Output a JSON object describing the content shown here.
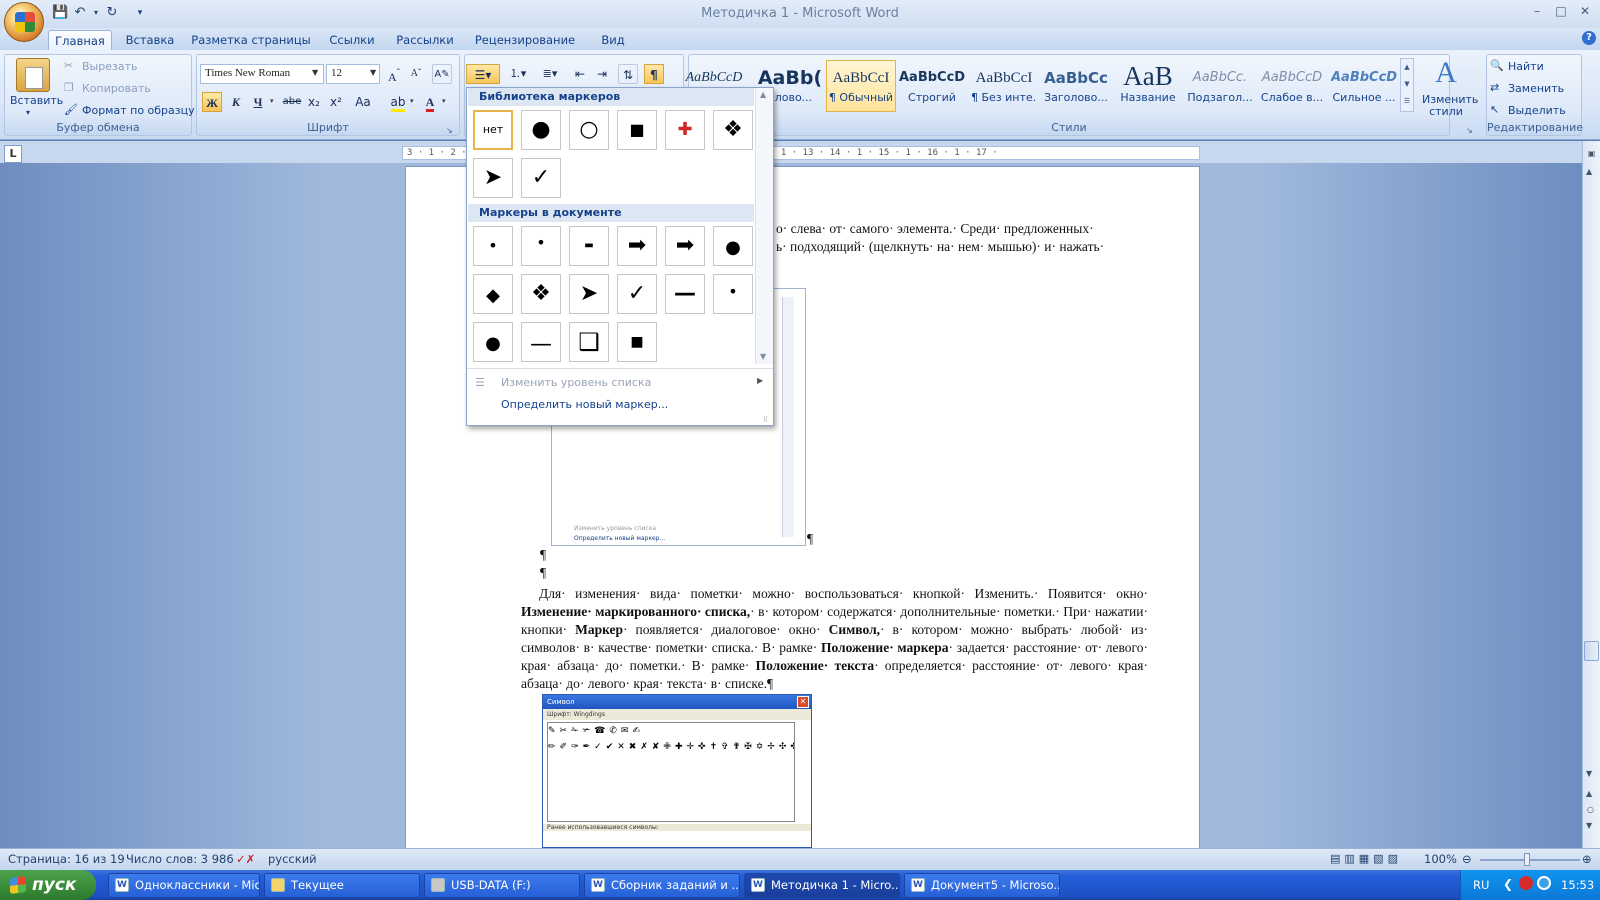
{
  "window": {
    "title": "Методичка 1 - Microsoft Word",
    "controls": {
      "minimize": "–",
      "maximize": "□",
      "close": "✕"
    }
  },
  "tabs": [
    "Главная",
    "Вставка",
    "Разметка страницы",
    "Ссылки",
    "Рассылки",
    "Рецензирование",
    "Вид"
  ],
  "active_tab": "Главная",
  "ribbon": {
    "clipboard": {
      "label": "Буфер обмена",
      "paste": "Вставить",
      "cut": "Вырезать",
      "copy": "Копировать",
      "format_painter": "Формат по образцу"
    },
    "font": {
      "label": "Шрифт",
      "font_name": "Times New Roman",
      "font_size": "12",
      "bold": "Ж",
      "italic": "К",
      "underline": "Ч",
      "strike": "abe",
      "sub": "x₂",
      "sup": "x²",
      "case": "Aa"
    },
    "styles": {
      "label": "Стили",
      "items": [
        {
          "sample": "AaBbCcD",
          "name": ""
        },
        {
          "sample": "AaBb(",
          "name": "оловo..."
        },
        {
          "sample": "AaBbCcI",
          "name": "¶ Обычный"
        },
        {
          "sample": "AaBbCcD",
          "name": "Строгий"
        },
        {
          "sample": "AaBbCcI",
          "name": "¶ Без инте..."
        },
        {
          "sample": "AaBbCc",
          "name": "Заголово..."
        },
        {
          "sample": "AaB",
          "name": "Название"
        },
        {
          "sample": "AaBbCc.",
          "name": "Подзагол..."
        },
        {
          "sample": "AaBbCcD",
          "name": "Слабое в..."
        },
        {
          "sample": "AaBbCcD",
          "name": "Сильное ..."
        }
      ],
      "change_styles": "Изменить стили"
    },
    "editing": {
      "label": "Редактирование",
      "find": "Найти",
      "replace": "Заменить",
      "select": "Выделить"
    }
  },
  "ruler": "3 · 1 · 2 · 1 · 1 ·                                                                  · 7 · 1 · 8 · 1 · 9 · 1 · 10 · 1 · 11 · 1 · 12 · 1 · 13 · 14 · 1 · 15 · 1 · 16 · 1 · 17 ·",
  "bullet_dropdown": {
    "library_header": "Библиотека маркеров",
    "library": [
      "нет",
      "●",
      "○",
      "■",
      "✚",
      "❖",
      "➤",
      "✓"
    ],
    "document_header": "Маркеры в документе",
    "document": [
      "•",
      "•",
      "▬",
      "➡",
      "➡",
      "●",
      "◆",
      "❖",
      "➤",
      "✓",
      "—",
      "•",
      "●",
      "—",
      "❑",
      "■"
    ],
    "change_level": "Изменить уровень списка",
    "define_new": "Определить новый маркер..."
  },
  "document": {
    "line1": "о· слева· от· самого· элемента.· Среди· предложенных·",
    "line2": "ь· подходящий· (щелкнуть· на· нем· мышью)· и· нажать·",
    "para_marks": [
      "¶",
      "¶",
      "¶"
    ],
    "para_html": "Для· изменения· вида· пометки· можно· воспользоваться· кнопкой· Изменить.· Появится· окно· <b>Изменение· маркированного· списка,</b>· в· котором· содержатся· дополнительные· пометки.· При· нажатии· кнопки· <b>Маркер</b>· появляется· диалоговое· окно· <b>Символ,</b>· в· котором· можно· выбрать· любой· из· символов· в· качестве· пометки· списка.· В· рамке· <b>Положение· маркера</b>· задается· расстояние· от· левого· края· абзаца· до· пометки.· В· рамке· <b>Положение· текста</b>· определяется· расстояние· от· левого· края· абзаца· до· левого· края· текста· в· списке.¶",
    "symbol_dialog_title": "Символ",
    "symbol_font_label": "Шрифт: Wingdings",
    "symbol_recent_label": "Ранее использовавшиеся символы:",
    "inset_change_level": "Изменить уровень списка",
    "inset_define": "Определить новый маркер..."
  },
  "status": {
    "page": "Страница: 16 из 19",
    "words": "Число слов: 3 986",
    "language": "русский",
    "zoom": "100%"
  },
  "taskbar": {
    "start": "пуск",
    "items": [
      "Одноклассники - Mic...",
      "Текущее",
      "USB-DATA (F:)",
      "Сборник заданий и ...",
      "Методичка 1 - Micro...",
      "Документ5 - Microso..."
    ],
    "active_index": 4,
    "lang": "RU",
    "time": "15:53"
  }
}
